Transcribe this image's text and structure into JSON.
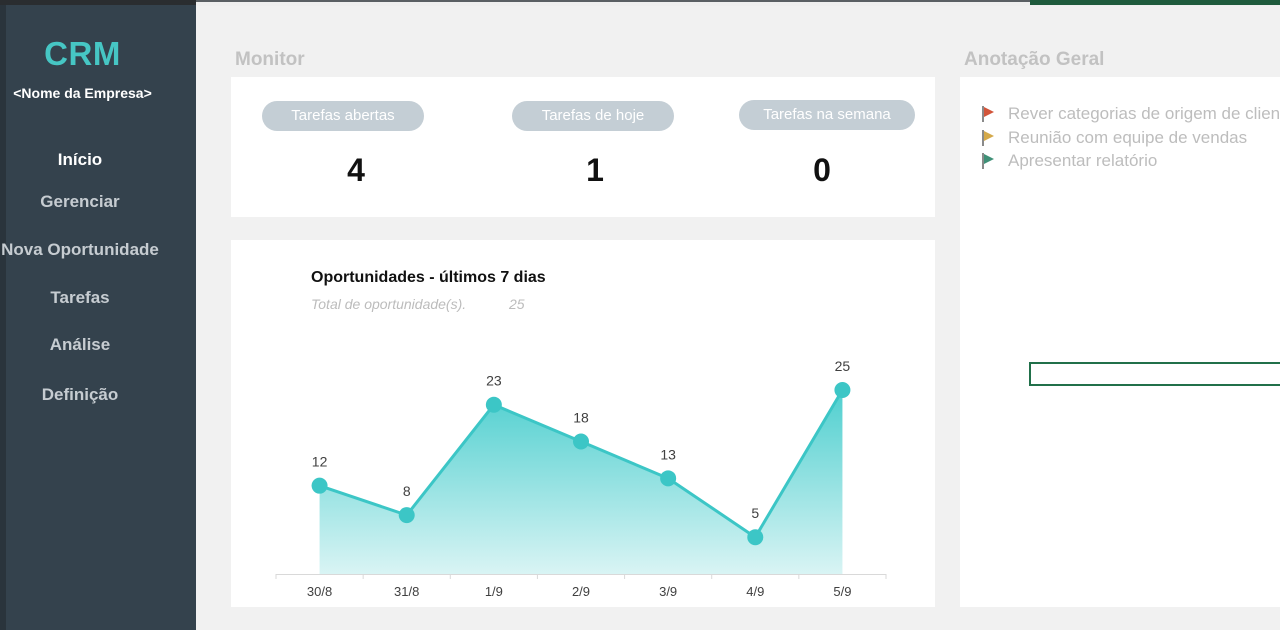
{
  "brand": {
    "logo": "CRM",
    "company": "<Nome da Empresa>"
  },
  "nav": [
    {
      "label": "Início",
      "active": true
    },
    {
      "label": "Gerenciar",
      "active": false
    },
    {
      "label": "Nova Oportunidade",
      "active": false
    },
    {
      "label": "Tarefas",
      "active": false
    },
    {
      "label": "Análise",
      "active": false
    },
    {
      "label": "Definição",
      "active": false
    }
  ],
  "monitor": {
    "title": "Monitor",
    "cards": [
      {
        "label": "Tarefas abertas",
        "value": "4"
      },
      {
        "label": "Tarefas de hoje",
        "value": "1"
      },
      {
        "label": "Tarefas na semana",
        "value": "0"
      }
    ]
  },
  "chart": {
    "title": "Oportunidades - últimos 7 dias",
    "subtitle": "Total de oportunidade(s).",
    "total": "25"
  },
  "chart_data": {
    "type": "area",
    "title": "Oportunidades - últimos 7 dias",
    "categories": [
      "30/8",
      "31/8",
      "1/9",
      "2/9",
      "3/9",
      "4/9",
      "5/9"
    ],
    "values": [
      12,
      8,
      23,
      18,
      13,
      5,
      25
    ],
    "ylim": [
      0,
      30
    ],
    "grid": false,
    "colors": {
      "line": "#3cc6c6",
      "fill_top": "#4fcfcf",
      "fill_bottom": "#d9f4f4"
    }
  },
  "notes": {
    "title": "Anotação Geral",
    "items": [
      {
        "text": "Rever categorias de origem de cliente",
        "flag_color": "#d2553a"
      },
      {
        "text": "Reunião com equipe de vendas",
        "flag_color": "#d4a94a"
      },
      {
        "text": "Apresentar relatório",
        "flag_color": "#3f9077"
      }
    ]
  }
}
